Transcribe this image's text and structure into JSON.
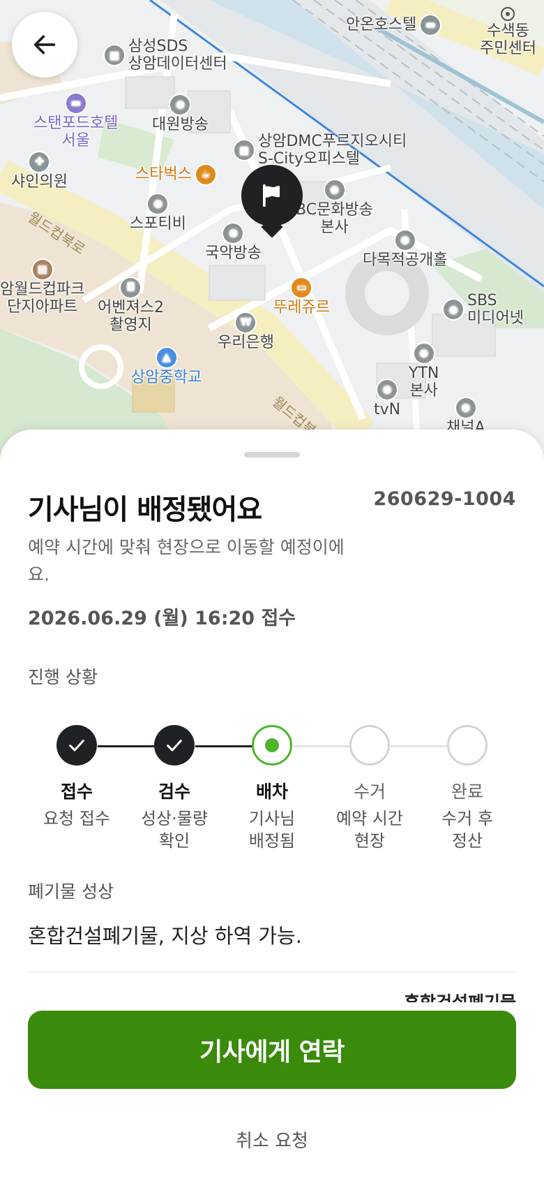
{
  "map": {
    "pois": [
      {
        "label": "안온호스텔",
        "icon": "hotel-icon"
      },
      {
        "label": "수색동\n주민센터",
        "icon": "location-icon"
      },
      {
        "label": "삼성SDS\n상암데이터센터",
        "icon": "building-icon"
      },
      {
        "label": "스탠포드호텔\n서울",
        "icon": "hotel-icon"
      },
      {
        "label": "대원방송",
        "icon": "broadcast-icon"
      },
      {
        "label": "상암DMC푸르지오시티\nS-City오피스텔",
        "icon": "building-icon"
      },
      {
        "label": "스타벅스",
        "icon": "cafe-icon"
      },
      {
        "label": "샤인의원",
        "icon": "hospital-icon"
      },
      {
        "label": "스포티비",
        "icon": "broadcast-icon"
      },
      {
        "label": "BC문화방송\n본사",
        "icon": "broadcast-icon"
      },
      {
        "label": "국악방송",
        "icon": "broadcast-icon"
      },
      {
        "label": "다목적공개홀",
        "icon": "broadcast-icon"
      },
      {
        "label": "암월드컵파크\n단지아파트",
        "icon": "apartment-icon"
      },
      {
        "label": "어벤져스2\n촬영지",
        "icon": "camera-icon"
      },
      {
        "label": "뚜레쥬르",
        "icon": "bakery-icon"
      },
      {
        "label": "SBS\n미디어넷",
        "icon": "broadcast-icon"
      },
      {
        "label": "우리은행",
        "icon": "bank-icon"
      },
      {
        "label": "상암중학교",
        "icon": "school-icon"
      },
      {
        "label": "YTN\n본사",
        "icon": "broadcast-icon"
      },
      {
        "label": "tvN",
        "icon": "broadcast-icon"
      },
      {
        "label": "채널A",
        "icon": "broadcast-icon"
      }
    ],
    "roads": [
      "월드컵북로",
      "월드컵북로"
    ],
    "marker_icon": "flag-icon"
  },
  "header": {
    "back_icon": "arrow-left-icon"
  },
  "status": {
    "title": "기사님이 배정됐어요",
    "order_number": "260629-1004",
    "description": "예약 시간에 맞춰 현장으로 이동할 예정이에요.",
    "received_at": "2026.06.29 (월) 16:20 접수"
  },
  "progress": {
    "label": "진행 상황",
    "current_index": 2,
    "steps": [
      {
        "name": "접수",
        "sub": "요청 접수"
      },
      {
        "name": "검수",
        "sub": "성상·물량\n확인"
      },
      {
        "name": "배차",
        "sub": "기사님\n배정됨"
      },
      {
        "name": "수거",
        "sub": "예약 시간\n현장"
      },
      {
        "name": "완료",
        "sub": "수거 후\n정산"
      }
    ]
  },
  "waste": {
    "label": "폐기물 성상",
    "description": "혼합건설폐기물, 지상 하역 가능.",
    "clipped_value": "혼합건설폐기물"
  },
  "actions": {
    "contact_label": "기사에게 연락",
    "cancel_label": "취소 요청"
  },
  "colors": {
    "accent_green": "#3a8a0c",
    "progress_green": "#4cb52a",
    "done_dark": "#1e2224"
  }
}
